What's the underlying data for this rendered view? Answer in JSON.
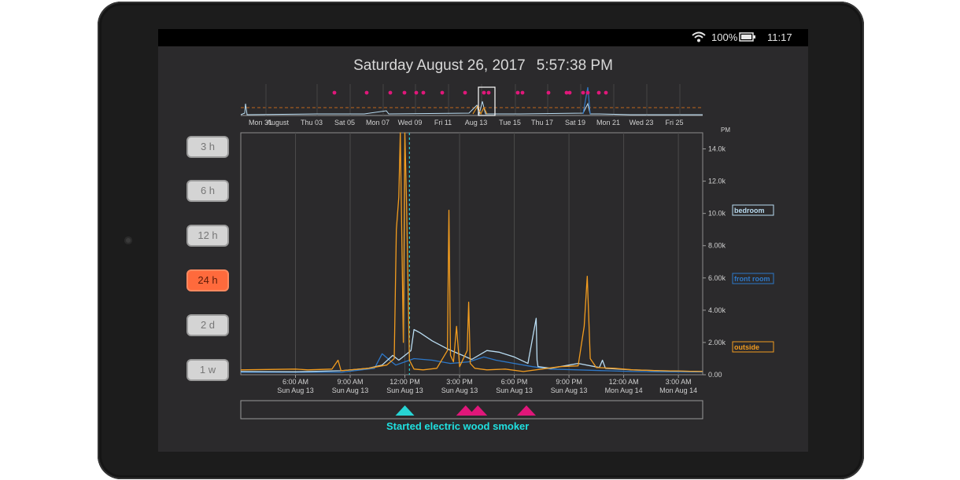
{
  "status": {
    "battery": "100%",
    "time": "11:17"
  },
  "header": {
    "date": "Saturday August 26, 2017",
    "time": "5:57:38 PM"
  },
  "ranges": [
    {
      "label": "3 h",
      "active": false
    },
    {
      "label": "6 h",
      "active": false
    },
    {
      "label": "12 h",
      "active": false
    },
    {
      "label": "24 h",
      "active": true
    },
    {
      "label": "2 d",
      "active": false
    },
    {
      "label": "1 w",
      "active": false
    }
  ],
  "overview": {
    "ticks": [
      "Mon 31",
      "August",
      "Thu 03",
      "Sat 05",
      "Mon 07",
      "Wed 09",
      "Fri 11",
      "Aug 13",
      "Tue 15",
      "Thu 17",
      "Sat 19",
      "Mon 21",
      "Wed 23",
      "Fri 25"
    ],
    "colors": {
      "marker": "#e0177a",
      "threshold": "#c2661c",
      "window": "#ffffff"
    }
  },
  "chart_data": {
    "type": "line",
    "ylabel": "",
    "unit_label": "PM",
    "ylim": [
      0,
      15000
    ],
    "yticks": [
      "0.00",
      "2.00k",
      "4.00k",
      "6.00k",
      "8.00k",
      "10.0k",
      "12.0k",
      "14.0k"
    ],
    "yvalues": [
      0,
      2000,
      4000,
      6000,
      8000,
      10000,
      12000,
      14000
    ],
    "xlim": [
      "2017-08-13T03:00",
      "2017-08-14T04:20"
    ],
    "xticks": [
      {
        "t": "2017-08-13T06:00",
        "line1": "6:00 AM",
        "line2": "Sun Aug 13"
      },
      {
        "t": "2017-08-13T09:00",
        "line1": "9:00 AM",
        "line2": "Sun Aug 13"
      },
      {
        "t": "2017-08-13T12:00",
        "line1": "12:00 PM",
        "line2": "Sun Aug 13"
      },
      {
        "t": "2017-08-13T15:00",
        "line1": "3:00 PM",
        "line2": "Sun Aug 13"
      },
      {
        "t": "2017-08-13T18:00",
        "line1": "6:00 PM",
        "line2": "Sun Aug 13"
      },
      {
        "t": "2017-08-13T21:00",
        "line1": "9:00 PM",
        "line2": "Sun Aug 13"
      },
      {
        "t": "2017-08-14T00:00",
        "line1": "12:00 AM",
        "line2": "Mon Aug 14"
      },
      {
        "t": "2017-08-14T03:00",
        "line1": "3:00 AM",
        "line2": "Mon Aug 14"
      }
    ],
    "series": [
      {
        "name": "bedroom",
        "color": "#b9dcf2",
        "x": [
          "2017-08-13T03:00",
          "2017-08-13T06:00",
          "2017-08-13T08:30",
          "2017-08-13T10:00",
          "2017-08-13T10:45",
          "2017-08-13T11:20",
          "2017-08-13T11:40",
          "2017-08-13T12:20",
          "2017-08-13T12:30",
          "2017-08-13T12:50",
          "2017-08-13T13:30",
          "2017-08-13T14:20",
          "2017-08-13T15:10",
          "2017-08-13T15:40",
          "2017-08-13T16:30",
          "2017-08-13T17:10",
          "2017-08-13T18:00",
          "2017-08-13T18:45",
          "2017-08-13T19:12",
          "2017-08-13T19:15",
          "2017-08-13T19:18",
          "2017-08-13T20:00",
          "2017-08-13T21:00",
          "2017-08-13T21:30",
          "2017-08-13T22:40",
          "2017-08-13T22:50",
          "2017-08-13T23:00",
          "2017-08-14T00:30",
          "2017-08-14T02:00",
          "2017-08-14T04:20"
        ],
        "y": [
          200,
          180,
          250,
          400,
          600,
          1200,
          900,
          1500,
          2800,
          2600,
          2100,
          1600,
          1200,
          950,
          1500,
          1400,
          1100,
          700,
          3500,
          900,
          500,
          400,
          600,
          700,
          450,
          900,
          400,
          300,
          250,
          200
        ]
      },
      {
        "name": "front room",
        "color": "#2d78c9",
        "x": [
          "2017-08-13T03:00",
          "2017-08-13T08:30",
          "2017-08-13T10:20",
          "2017-08-13T10:45",
          "2017-08-13T11:10",
          "2017-08-13T11:30",
          "2017-08-13T12:00",
          "2017-08-13T12:30",
          "2017-08-13T13:30",
          "2017-08-13T14:30",
          "2017-08-13T15:30",
          "2017-08-13T16:20",
          "2017-08-13T17:00",
          "2017-08-13T18:00",
          "2017-08-13T19:00",
          "2017-08-13T20:00",
          "2017-08-13T21:30",
          "2017-08-13T23:00",
          "2017-08-14T00:30",
          "2017-08-14T02:00",
          "2017-08-14T04:20"
        ],
        "y": [
          150,
          150,
          400,
          1300,
          900,
          600,
          800,
          1000,
          900,
          700,
          800,
          1100,
          900,
          700,
          500,
          350,
          300,
          250,
          200,
          180,
          170
        ]
      },
      {
        "name": "outside",
        "color": "#f29c1f",
        "x": [
          "2017-08-13T03:00",
          "2017-08-13T06:00",
          "2017-08-13T06:40",
          "2017-08-13T08:00",
          "2017-08-13T08:20",
          "2017-08-13T08:30",
          "2017-08-13T10:00",
          "2017-08-13T11:00",
          "2017-08-13T11:25",
          "2017-08-13T11:32",
          "2017-08-13T11:40",
          "2017-08-13T11:45",
          "2017-08-13T11:55",
          "2017-08-13T12:00",
          "2017-08-13T12:05",
          "2017-08-13T12:15",
          "2017-08-13T12:30",
          "2017-08-13T13:00",
          "2017-08-13T13:45",
          "2017-08-13T14:20",
          "2017-08-13T14:25",
          "2017-08-13T14:30",
          "2017-08-13T14:40",
          "2017-08-13T14:50",
          "2017-08-13T15:00",
          "2017-08-13T15:25",
          "2017-08-13T15:30",
          "2017-08-13T15:35",
          "2017-08-13T15:50",
          "2017-08-13T16:30",
          "2017-08-13T17:30",
          "2017-08-13T18:30",
          "2017-08-13T19:30",
          "2017-08-13T20:30",
          "2017-08-13T21:30",
          "2017-08-13T21:50",
          "2017-08-13T22:00",
          "2017-08-13T22:10",
          "2017-08-13T22:30",
          "2017-08-13T23:30",
          "2017-08-14T00:30",
          "2017-08-14T02:00",
          "2017-08-14T04:20"
        ],
        "y": [
          300,
          350,
          300,
          350,
          900,
          250,
          400,
          600,
          1000,
          9000,
          11000,
          15000,
          2000,
          15000,
          11000,
          900,
          350,
          300,
          400,
          1500,
          10200,
          1200,
          800,
          3000,
          500,
          1500,
          4500,
          700,
          400,
          300,
          350,
          200,
          350,
          500,
          550,
          3000,
          6100,
          1000,
          450,
          400,
          300,
          250,
          200
        ]
      }
    ],
    "legend": [
      "bedroom",
      "front room",
      "outside"
    ],
    "cursor": "2017-08-13T12:15",
    "events": [
      {
        "t": "2017-08-13T12:00",
        "color": "#27d4d4"
      },
      {
        "t": "2017-08-13T15:20",
        "color": "#e0177a"
      },
      {
        "t": "2017-08-13T16:00",
        "color": "#e0177a"
      },
      {
        "t": "2017-08-13T18:40",
        "color": "#e0177a"
      }
    ],
    "event_caption": "Started electric wood smoker"
  }
}
